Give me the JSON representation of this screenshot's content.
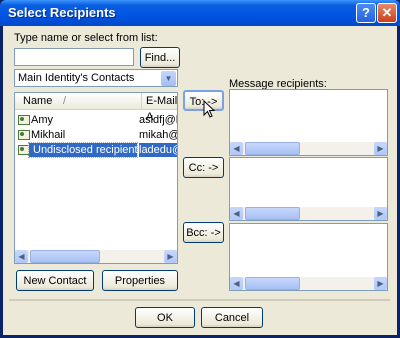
{
  "window": {
    "title": "Select Recipients",
    "help_glyph": "?",
    "close_glyph": "✕"
  },
  "search": {
    "label": "Type name or select from list:",
    "value": "",
    "find_label": "Find..."
  },
  "source": {
    "selected": "Main Identity's Contacts",
    "arrow": "▼"
  },
  "contacts": {
    "columns": [
      "Name",
      "E-Mail A"
    ],
    "sort_glyph": "/",
    "rows": [
      {
        "name": "Amy",
        "email": "asldfj@lj"
      },
      {
        "name": "Mikhail",
        "email": "mikah@"
      },
      {
        "name": "Undisclosed recipients",
        "email": "ladedu@"
      }
    ]
  },
  "buttons": {
    "new_contact": "New Contact",
    "properties": "Properties",
    "to": "To: ->",
    "cc": "Cc: ->",
    "bcc": "Bcc: ->",
    "ok": "OK",
    "cancel": "Cancel"
  },
  "recipients": {
    "label": "Message recipients:"
  },
  "scroll": {
    "left": "◀",
    "right": "▶"
  }
}
